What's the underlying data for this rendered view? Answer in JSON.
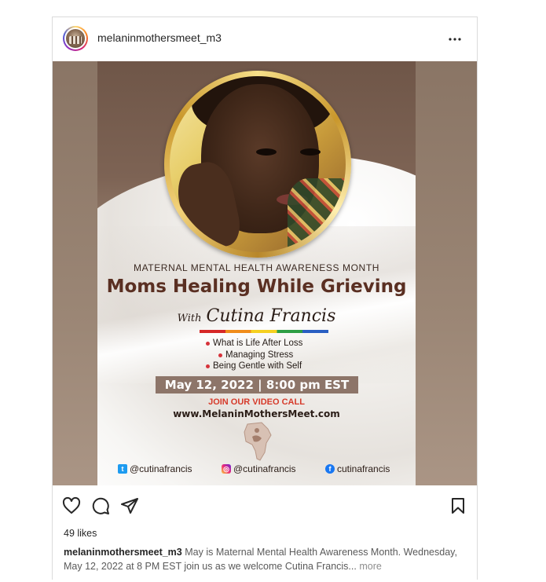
{
  "post": {
    "username": "melaninmothersmeet_m3",
    "more_options_icon": "ellipsis-icon",
    "likes": "49 likes",
    "caption_user": "melaninmothersmeet_m3",
    "caption_text": " May is Maternal Mental Health Awareness Month. Wednesday, May 12, 2022 at 8 PM EST join us as we welcome Cutina Francis... ",
    "caption_more": "more",
    "actions": [
      "heart-icon",
      "comment-icon",
      "share-icon",
      "bookmark-icon"
    ]
  },
  "poster": {
    "kicker": "MATERNAL MENTAL HEALTH AWARENESS MONTH",
    "headline": "Moms Healing While Grieving",
    "with_prefix": "With",
    "speaker": "Cutina Francis",
    "bullets": [
      "What is Life After Loss",
      "Managing Stress",
      "Being Gentle with Self"
    ],
    "date_time": "May 12, 2022 | 8:00 pm EST",
    "join": "JOIN OUR VIDEO CALL",
    "website": "www.MelaninMothersMeet.com",
    "socials": {
      "twitter": "@cutinafrancis",
      "instagram": "@cutinafrancis",
      "facebook": "cutinafrancis"
    }
  },
  "colors": {
    "headline": "#5a2f22",
    "date_bar": "#8d7569",
    "join": "#d63a2a",
    "gold_frame": "#c9972c"
  }
}
